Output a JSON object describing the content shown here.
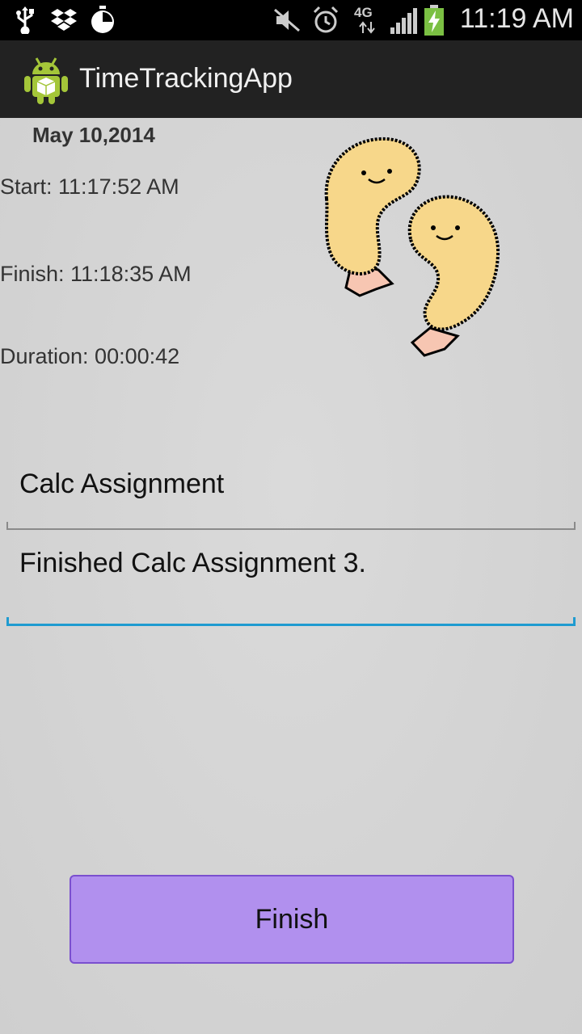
{
  "status_bar": {
    "time": "11:19 AM",
    "network": "4G",
    "icons": [
      "usb-icon",
      "dropbox-icon",
      "timer-icon",
      "mute-icon",
      "alarm-icon",
      "network-4g-icon",
      "signal-icon",
      "battery-charging-icon"
    ]
  },
  "action_bar": {
    "title": "TimeTrackingApp",
    "icon": "android-app-icon"
  },
  "session": {
    "date": "May 10,2014",
    "start": "Start: 11:17:52 AM",
    "finish": "Finish: 11:18:35 AM",
    "duration": "Duration: 00:00:42"
  },
  "form": {
    "task_name": "Calc Assignment",
    "notes": "Finished Calc Assignment 3."
  },
  "buttons": {
    "finish_label": "Finish"
  },
  "colors": {
    "status_bar": "#000000",
    "action_bar": "#222222",
    "background": "#d4d4d4",
    "focused_underline": "#1f9bd0",
    "finish_button": "#b190ee",
    "finish_button_border": "#7a4fcf"
  },
  "illustration": "two-cartoon-fried-shrimp"
}
